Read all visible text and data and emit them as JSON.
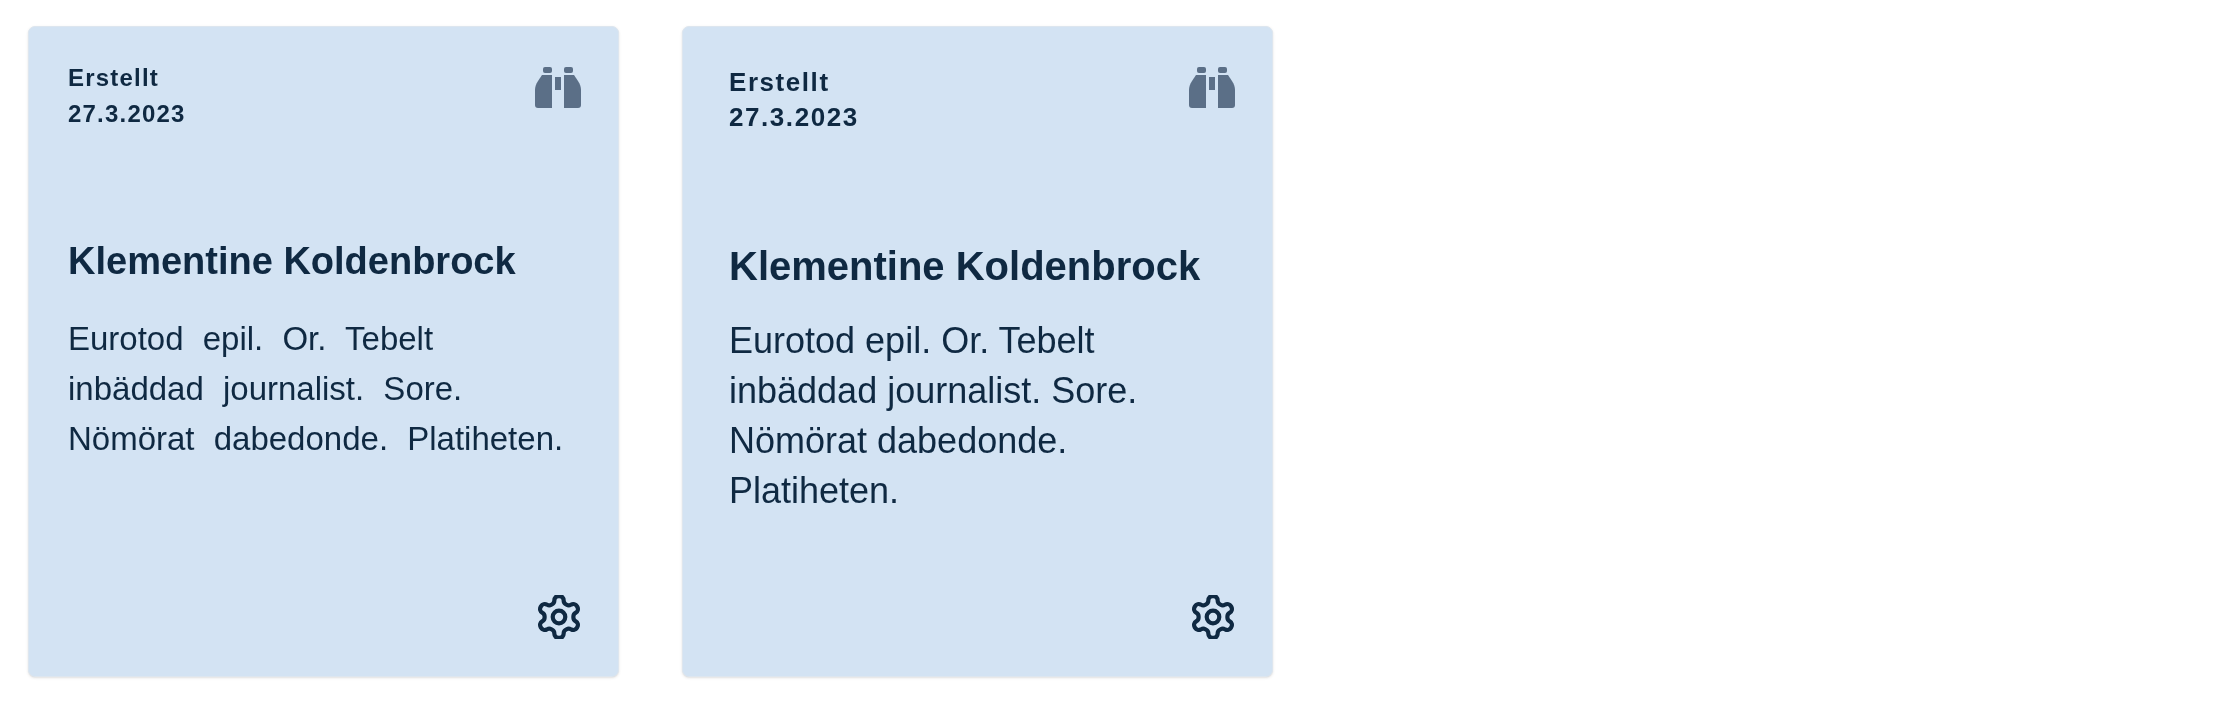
{
  "cards": [
    {
      "kind": "geometric",
      "created_label": "Erstellt",
      "created_date": "27.3.2023",
      "title": "Klementine Koldenbrock",
      "description": "Eurotod epil. Or. Tebelt inbäddad journalist. Sore. Nömörat dabedonde. Platiheten."
    },
    {
      "kind": "grotesque",
      "created_label": "Erstellt",
      "created_date": "27.3.2023",
      "title": "Klementine Koldenbrock",
      "description": "Eurotod epil. Or. Tebelt inbäddad journalist. Sore. Nömörat dabedonde. Platiheten."
    }
  ]
}
